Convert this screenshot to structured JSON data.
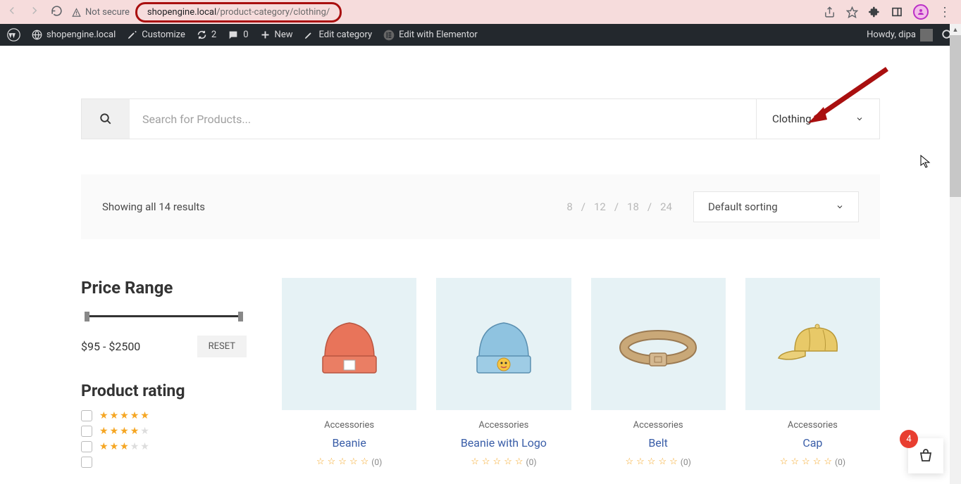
{
  "browser": {
    "security_label": "Not secure",
    "url_host": "shopengine.local",
    "url_path": "/product-category/clothing/"
  },
  "wpbar": {
    "site_name": "shopengine.local",
    "customize": "Customize",
    "updates": "2",
    "comments": "0",
    "new": "New",
    "edit_category": "Edit category",
    "edit_elementor": "Edit with Elementor",
    "howdy": "Howdy, dipa"
  },
  "search": {
    "placeholder": "Search for Products...",
    "category": "Clothing"
  },
  "results": {
    "count_text": "Showing all 14 results",
    "per_page": [
      "8",
      "12",
      "18",
      "24"
    ],
    "sort_label": "Default sorting"
  },
  "sidebar": {
    "price_title": "Price Range",
    "price_value": "$95 - $2500",
    "reset": "RESET",
    "rating_title": "Product rating"
  },
  "products": [
    {
      "category": "Accessories",
      "name": "Beanie",
      "reviews": "(0)"
    },
    {
      "category": "Accessories",
      "name": "Beanie with Logo",
      "reviews": "(0)"
    },
    {
      "category": "Accessories",
      "name": "Belt",
      "reviews": "(0)"
    },
    {
      "category": "Accessories",
      "name": "Cap",
      "reviews": "(0)"
    }
  ],
  "cart": {
    "count": "4"
  }
}
